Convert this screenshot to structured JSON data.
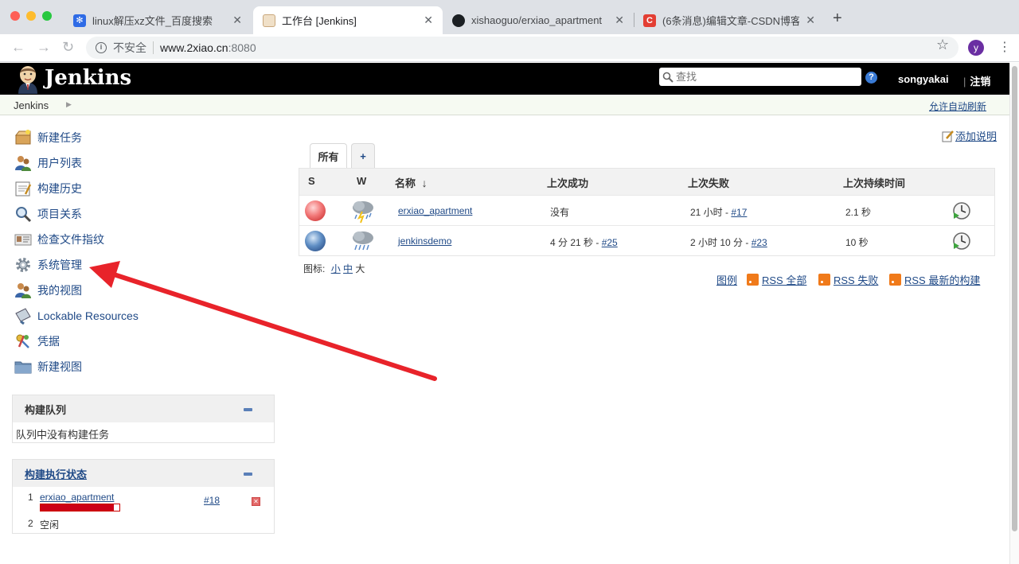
{
  "browser": {
    "tabs": [
      {
        "title": "linux解压xz文件_百度搜索",
        "active": false
      },
      {
        "title": "工作台 [Jenkins]",
        "active": true
      },
      {
        "title": "xishaoguo/erxiao_apartment",
        "active": false
      },
      {
        "title": "(6条消息)编辑文章-CSDN博客",
        "active": false
      }
    ],
    "insecure_label": "不安全",
    "url_host": "www.2xiao.cn",
    "url_port": ":8080",
    "profile_initial": "y"
  },
  "header": {
    "brand": "Jenkins",
    "search_placeholder": "查找",
    "username": "songyakai",
    "logout": "注销"
  },
  "breadcrumb": {
    "root": "Jenkins",
    "auto_refresh": "允许自动刷新"
  },
  "sidebar": {
    "tasks": [
      {
        "label": "新建任务",
        "icon": "new-package-icon"
      },
      {
        "label": "用户列表",
        "icon": "users-icon"
      },
      {
        "label": "构建历史",
        "icon": "notepad-icon"
      },
      {
        "label": "项目关系",
        "icon": "search-icon"
      },
      {
        "label": "检查文件指纹",
        "icon": "fingerprint-icon"
      },
      {
        "label": "系统管理",
        "icon": "gear-icon"
      },
      {
        "label": "我的视图",
        "icon": "user-icon"
      },
      {
        "label": "Lockable Resources",
        "icon": "usb-icon"
      },
      {
        "label": "凭据",
        "icon": "keys-icon"
      },
      {
        "label": "新建视图",
        "icon": "folder-icon"
      }
    ],
    "build_queue": {
      "title": "构建队列",
      "empty_text": "队列中没有构建任务"
    },
    "executors": {
      "title": "构建执行状态",
      "items": [
        {
          "num": "1",
          "job": "erxiao_apartment",
          "build": "#18",
          "progress": 0.93
        },
        {
          "num": "2",
          "status": "空闲"
        }
      ]
    }
  },
  "main": {
    "add_description": "添加说明",
    "views": [
      {
        "label": "所有"
      },
      {
        "label": "+"
      }
    ],
    "table": {
      "headers": [
        "S",
        "W",
        "名称",
        "上次成功",
        "上次失败",
        "上次持续时间"
      ],
      "sort_arrow": "↓",
      "rows": [
        {
          "status": "red",
          "name": "erxiao_apartment",
          "last_success": "没有",
          "last_success_link": "",
          "last_failure": "21 小时 - ",
          "last_failure_link": "#17",
          "duration": "2.1 秒"
        },
        {
          "status": "blue",
          "name": "jenkinsdemo",
          "last_success": "4 分 21 秒 - ",
          "last_success_link": "#25",
          "last_failure": "2 小时 10 分 - ",
          "last_failure_link": "#23",
          "duration": "10 秒"
        }
      ]
    },
    "icon_size": {
      "label": "图标:",
      "small": "小",
      "medium": "中",
      "large": "大"
    },
    "legend": "图例",
    "rss_all": "RSS 全部",
    "rss_failed": "RSS 失败",
    "rss_latest": "RSS 最新的构建"
  },
  "annotation": {
    "color": "#e8232a"
  }
}
